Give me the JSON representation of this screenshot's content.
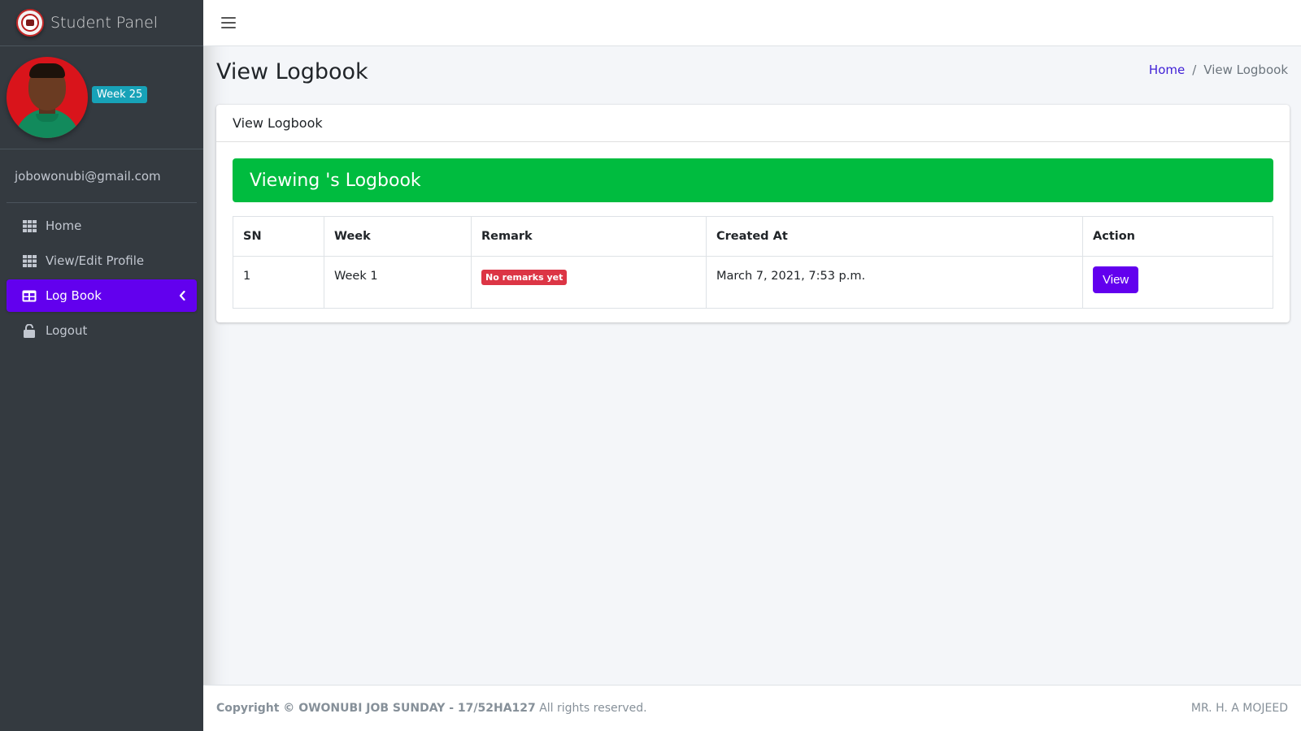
{
  "brand": {
    "title": "Student Panel"
  },
  "user": {
    "week_badge": "Week 25",
    "email": "jobowonubi@gmail.com"
  },
  "sidebar": {
    "items": [
      {
        "label": "Home",
        "icon": "grid-icon",
        "active": false
      },
      {
        "label": "View/Edit Profile",
        "icon": "grid-icon",
        "active": false
      },
      {
        "label": "Log Book",
        "icon": "table-icon",
        "active": true
      },
      {
        "label": "Logout",
        "icon": "unlock-icon",
        "active": false
      }
    ]
  },
  "page": {
    "title": "View Logbook",
    "breadcrumb": {
      "home": "Home",
      "separator": "/",
      "current": "View Logbook"
    }
  },
  "card": {
    "header": "View Logbook",
    "alert": "Viewing 's Logbook",
    "table": {
      "columns": [
        "SN",
        "Week",
        "Remark",
        "Created At",
        "Action"
      ],
      "rows": [
        {
          "sn": "1",
          "week": "Week 1",
          "remark": "No remarks yet",
          "created_at": "March 7, 2021, 7:53 p.m.",
          "action": "View"
        }
      ]
    }
  },
  "footer": {
    "copyright_prefix": "Copyright ©",
    "copyright_name": "OWONUBI JOB SUNDAY - 17/52HA127",
    "rights": "All rights reserved.",
    "right_text": "MR. H. A MOJEED"
  },
  "colors": {
    "sidebar_bg": "#343a40",
    "accent": "#6200ee",
    "alert_green": "#00bc3f",
    "badge_red": "#dc3545",
    "info_badge": "#17a2b8"
  }
}
